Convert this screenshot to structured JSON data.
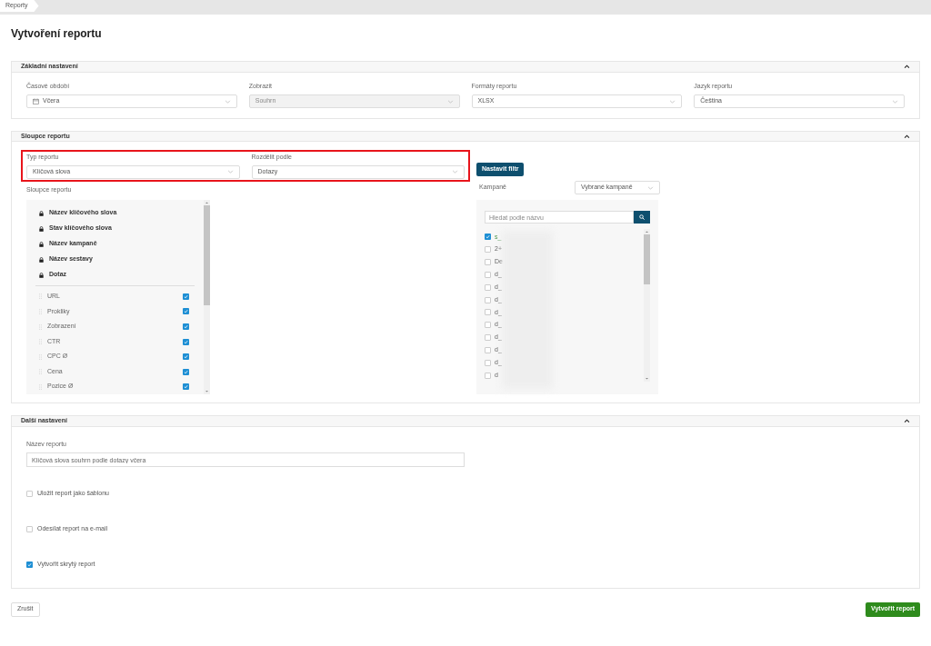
{
  "breadcrumb": [
    "Reporty"
  ],
  "title": "Vytvoření reportu",
  "sections": [
    {
      "kind": "basic",
      "title": "Základní nastavení",
      "expanded": true,
      "fields": [
        {
          "kind": "date",
          "label": "Časové období",
          "value": "Včera",
          "disabled": false
        },
        {
          "kind": "select",
          "label": "Zobrazit",
          "value": "Souhrn",
          "disabled": true
        },
        {
          "kind": "select",
          "label": "Formáty reportu",
          "value": "XLSX",
          "disabled": false
        },
        {
          "kind": "select",
          "label": "Jazyk reportu",
          "value": "Čeština",
          "disabled": false
        }
      ]
    },
    {
      "kind": "columns",
      "title": "Sloupce reportu",
      "expanded": true,
      "type_field": {
        "label": "Typ reportu",
        "value": "Klíčová slova"
      },
      "split_field": {
        "label": "Rozdělit podle",
        "value": "Dotazy"
      },
      "highlighted": true,
      "filter_button": "Nastavit filtr",
      "columns_label": "Sloupce reportu",
      "locked_columns": [
        "Název klíčového slova",
        "Stav klíčového slova",
        "Název kampaně",
        "Název sestavy",
        "Dotaz"
      ],
      "columns": [
        {
          "label": "URL",
          "checked": true
        },
        {
          "label": "Prokliky",
          "checked": true
        },
        {
          "label": "Zobrazení",
          "checked": true
        },
        {
          "label": "CTR",
          "checked": true
        },
        {
          "label": "CPC Ø",
          "checked": true
        },
        {
          "label": "Cena",
          "checked": true
        },
        {
          "label": "Pozice Ø",
          "checked": true
        }
      ],
      "campaigns_label": "Kampaně",
      "campaigns_select": "Vybrané kampaně",
      "campaign_search_placeholder": "Hledat podle názvu",
      "campaigns": [
        {
          "label": "s_",
          "checked": true
        },
        {
          "label": "2+",
          "checked": false
        },
        {
          "label": "De",
          "checked": false
        },
        {
          "label": "d_",
          "checked": false
        },
        {
          "label": "d_",
          "checked": false
        },
        {
          "label": "d_",
          "checked": false
        },
        {
          "label": "d_",
          "checked": false
        },
        {
          "label": "d_",
          "checked": false
        },
        {
          "label": "d_",
          "checked": false
        },
        {
          "label": "d_",
          "checked": false
        },
        {
          "label": "d_",
          "checked": false
        },
        {
          "label": "d",
          "checked": false
        }
      ]
    },
    {
      "kind": "more",
      "title": "Další nastavení",
      "expanded": true,
      "name_label": "Název reportu",
      "name_value": "Klíčová slova souhrn podle dotazy včera",
      "options": [
        {
          "label": "Uložit report jako šablonu",
          "checked": false
        },
        {
          "label": "Odesílat report na e-mail",
          "checked": false
        },
        {
          "label": "Vytvořit skrytý report",
          "checked": true
        }
      ]
    }
  ],
  "cancel_button": "Zrušit",
  "submit_button": "Vytvořit report"
}
